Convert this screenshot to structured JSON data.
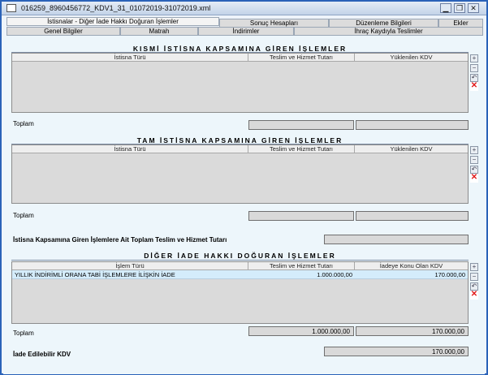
{
  "window": {
    "title": "016259_8960456772_KDV1_31_01072019-31072019.xml",
    "controls": [
      "minimize",
      "restore",
      "close"
    ]
  },
  "tabs": {
    "row1": [
      {
        "label": "İstisnalar - Diğer İade Hakkı Doğuran İşlemler",
        "active": true
      },
      {
        "label": "Sonuç Hesapları",
        "active": false
      },
      {
        "label": "Düzenleme Bilgileri",
        "active": false
      },
      {
        "label": "Ekler",
        "active": false
      }
    ],
    "row2": [
      {
        "label": "Genel Bilgiler"
      },
      {
        "label": "Matrah"
      },
      {
        "label": "İndirimler"
      },
      {
        "label": "İhraç Kaydıyla Teslimler"
      }
    ]
  },
  "sections": {
    "kismi": {
      "title": "KISMİ İSTİSNA KAPSAMINA GİREN İŞLEMLER",
      "columns": [
        "İstisna Türü",
        "Teslim ve Hizmet Tutarı",
        "Yüklenilen KDV"
      ],
      "total_label": "Toplam",
      "total_delivery": "",
      "total_vat": ""
    },
    "tam": {
      "title": "TAM İSTİSNA KAPSAMINA GİREN İŞLEMLER",
      "columns": [
        "İstisna Türü",
        "Teslim ve Hizmet Tutarı",
        "Yüklenilen KDV"
      ],
      "total_label": "Toplam",
      "total_delivery": "",
      "total_vat": ""
    },
    "summary": {
      "label": "İstisna Kapsamına Giren İşlemlere Ait Toplam Teslim ve Hizmet Tutarı",
      "value": ""
    },
    "diger": {
      "title": "DİĞER İADE HAKKI DOĞURAN İŞLEMLER",
      "columns": [
        "İşlem Türü",
        "Teslim ve Hizmet Tutarı",
        "İadeye Konu Olan KDV"
      ],
      "rows": [
        {
          "type": "YILLIK İNDİRİMLİ ORANA TABİ İŞLEMLERE İLİŞKİN İADE",
          "amount": "1.000.000,00",
          "vat": "170.000,00"
        }
      ],
      "total_label": "Toplam",
      "total_delivery": "1.000.000,00",
      "total_vat": "170.000,00"
    },
    "refundable": {
      "label": "İade Edilebilir KDV",
      "value": "170.000,00"
    }
  },
  "side_buttons": [
    "add-row",
    "remove-row",
    "undo-row",
    "delete-all"
  ],
  "colors": {
    "selected_row": "#d4ecfb",
    "window_border": "#2a62b8",
    "delete_icon": "#e21b1b"
  }
}
